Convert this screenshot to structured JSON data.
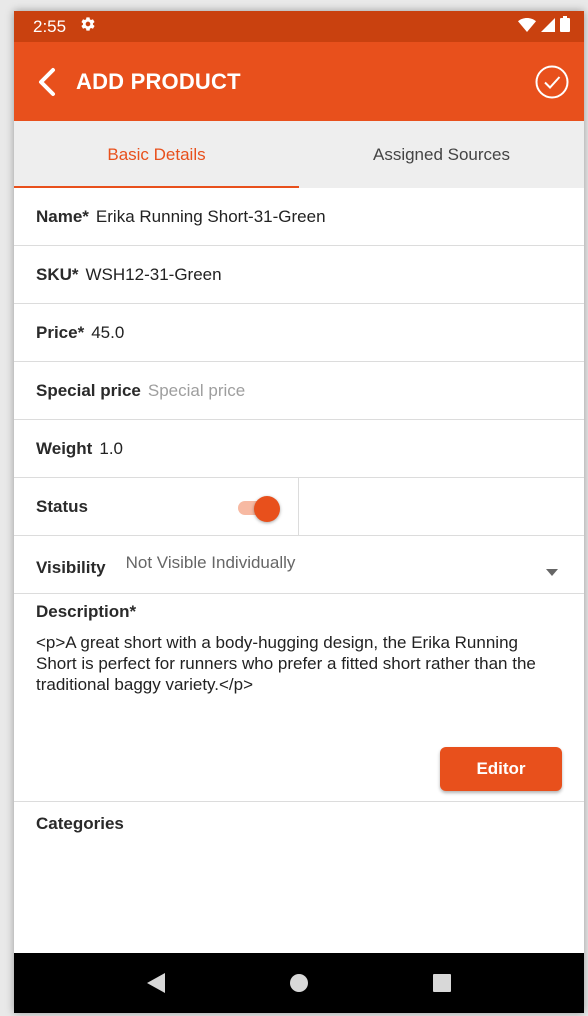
{
  "status_bar": {
    "time": "2:55"
  },
  "app_bar": {
    "title": "ADD PRODUCT"
  },
  "tabs": [
    {
      "label": "Basic Details",
      "active": true
    },
    {
      "label": "Assigned Sources",
      "active": false
    }
  ],
  "form": {
    "name": {
      "label": "Name*",
      "value": "Erika Running Short-31-Green"
    },
    "sku": {
      "label": "SKU*",
      "value": "WSH12-31-Green"
    },
    "price": {
      "label": "Price*",
      "value": "45.0"
    },
    "special_price": {
      "label": "Special price",
      "value": "",
      "placeholder": "Special price"
    },
    "weight": {
      "label": "Weight",
      "value": "1.0"
    },
    "status": {
      "label": "Status",
      "enabled": true
    },
    "visibility": {
      "label": "Visibility",
      "selected": "Not Visible Individually"
    },
    "description": {
      "label": "Description*",
      "value": "<p>A great short with a body-hugging design, the Erika Running Short is perfect for runners who prefer a fitted short rather than the traditional baggy variety.</p>",
      "editor_label": "Editor"
    },
    "categories": {
      "label": "Categories"
    }
  },
  "colors": {
    "accent": "#e8501c",
    "status_bar": "#c9410f",
    "toggle_track": "#f7b9a2"
  },
  "icons": {
    "back": "chevron-left-icon",
    "done": "check-circle-icon",
    "settings": "gear-icon",
    "wifi": "wifi-icon",
    "signal": "signal-icon",
    "battery": "battery-icon",
    "dropdown": "caret-down-icon"
  }
}
